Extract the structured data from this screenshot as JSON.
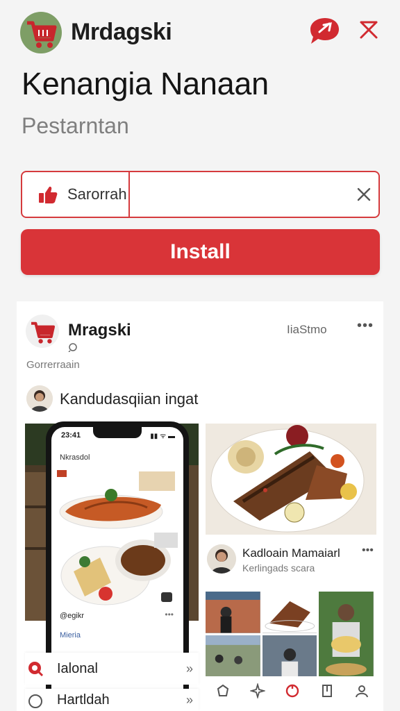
{
  "header": {
    "app_name": "Mrdagski",
    "title": "Kenangia Nanaan",
    "subtitle": "Pestarntan"
  },
  "search": {
    "left_label": "Sarorrah",
    "placeholder": "",
    "value": ""
  },
  "install": {
    "label": "Install"
  },
  "post": {
    "author": "Mragski",
    "meta": "IiaStmo",
    "more": "•••",
    "caption": "Gorrerraain",
    "comment": "Kandudasqiian ingat",
    "phone": {
      "time": "23:41",
      "status": "▮▮ ᯤ ▬",
      "app_name": "Nkrasdol",
      "handle": "@egikr",
      "dots": "•••",
      "tab": "Mieria"
    },
    "secondary": {
      "name": "Kadloain Mamaiarl",
      "sub": "Kerlingads scara",
      "more": "•••"
    }
  },
  "list_items": [
    {
      "label": "Ialonal",
      "chevron": "»"
    },
    {
      "label": "Hartldah",
      "chevron": "»"
    }
  ],
  "colors": {
    "accent": "#d93438",
    "logo_bg": "#7e9e66"
  },
  "icons": [
    "cart-icon",
    "chat-icon",
    "close-icon",
    "thumbs-up-icon",
    "clear-icon",
    "clock-icon",
    "more-icon",
    "home-icon",
    "explore-icon",
    "pin-icon",
    "bookmark-icon",
    "profile-icon",
    "chevron-right-icon"
  ]
}
